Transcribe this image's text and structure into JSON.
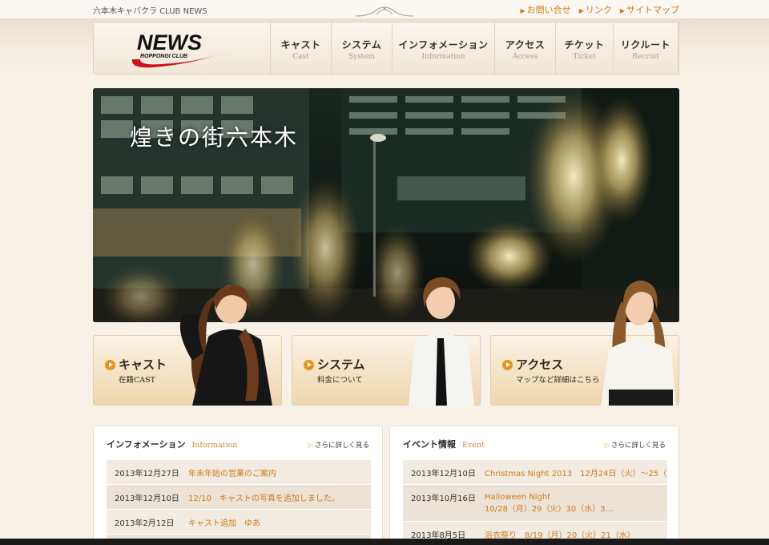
{
  "top": {
    "site_title": "六本木キャバクラ CLUB NEWS",
    "links": [
      "お問い合せ",
      "リンク",
      "サイトマップ"
    ]
  },
  "logo": {
    "main": "NEWS",
    "sub": "ROPPONGI CLUB"
  },
  "nav": [
    {
      "jp": "キャスト",
      "en": "Cast"
    },
    {
      "jp": "システム",
      "en": "System"
    },
    {
      "jp": "インフォメーション",
      "en": "Information"
    },
    {
      "jp": "アクセス",
      "en": "Access"
    },
    {
      "jp": "チケット",
      "en": "Ticket"
    },
    {
      "jp": "リクルート",
      "en": "Recruit"
    }
  ],
  "hero": {
    "title": "煌きの街六本木"
  },
  "cards": [
    {
      "title": "キャスト",
      "sub": "在籍CAST"
    },
    {
      "title": "システム",
      "sub": "料金について"
    },
    {
      "title": "アクセス",
      "sub": "マップなど詳細はこちら"
    }
  ],
  "info": {
    "title": "インフォメーション",
    "title_en": "Information",
    "more": "さらに詳しく見る",
    "rows": [
      {
        "date": "2013年12月27日",
        "text": "年末年始の営業のご案内"
      },
      {
        "date": "2013年12月10日",
        "text": "12/10　キャストの写真を追加しました。"
      },
      {
        "date": "2013年2月12日",
        "text": "キャスト追加　ゆあ"
      }
    ]
  },
  "event": {
    "title": "イベント情報",
    "title_en": "Event",
    "more": "さらに詳しく見る",
    "rows": [
      {
        "date": "2013年12月10日",
        "text": "Christmas Night 2013　12月24日（火）～25（…",
        "text2": ""
      },
      {
        "date": "2013年10月16日",
        "text": "Halloween Night",
        "text2": "10/28（月）29（火）30（水）3…"
      },
      {
        "date": "2013年8月5日",
        "text": "浴衣祭り　8/19（月）20（火）21（水）",
        "text2": ""
      }
    ]
  },
  "colors": {
    "accent": "#d07a1a",
    "bg": "#f7f1e8",
    "logo_red": "#c8141e"
  }
}
